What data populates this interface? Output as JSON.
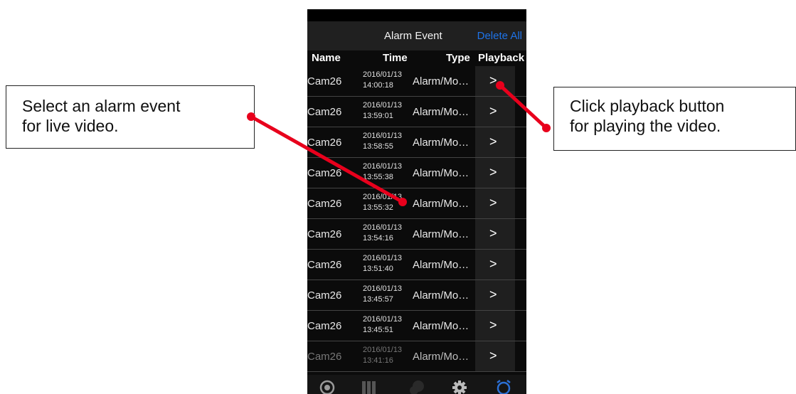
{
  "callouts": {
    "left": {
      "line1": "Select an alarm event",
      "line2": "for live video."
    },
    "right": {
      "line1": "Click playback button",
      "line2": "for playing the video."
    }
  },
  "nav": {
    "title": "Alarm Event",
    "delete_all": "Delete All"
  },
  "columns": {
    "name": "Name",
    "time": "Time",
    "type": "Type",
    "playback": "Playback"
  },
  "events": [
    {
      "name": "Cam26",
      "date": "2016/01/13",
      "time": "14:00:18",
      "type": "Alarm/Mo…",
      "play": ">"
    },
    {
      "name": "Cam26",
      "date": "2016/01/13",
      "time": "13:59:01",
      "type": "Alarm/Mo…",
      "play": ">"
    },
    {
      "name": "Cam26",
      "date": "2016/01/13",
      "time": "13:58:55",
      "type": "Alarm/Mo…",
      "play": ">"
    },
    {
      "name": "Cam26",
      "date": "2016/01/13",
      "time": "13:55:38",
      "type": "Alarm/Mo…",
      "play": ">"
    },
    {
      "name": "Cam26",
      "date": "2016/01/13",
      "time": "13:55:32",
      "type": "Alarm/Mo…",
      "play": ">"
    },
    {
      "name": "Cam26",
      "date": "2016/01/13",
      "time": "13:54:16",
      "type": "Alarm/Mo…",
      "play": ">"
    },
    {
      "name": "Cam26",
      "date": "2016/01/13",
      "time": "13:51:40",
      "type": "Alarm/Mo…",
      "play": ">"
    },
    {
      "name": "Cam26",
      "date": "2016/01/13",
      "time": "13:45:57",
      "type": "Alarm/Mo…",
      "play": ">"
    },
    {
      "name": "Cam26",
      "date": "2016/01/13",
      "time": "13:45:51",
      "type": "Alarm/Mo…",
      "play": ">"
    },
    {
      "name": "Cam26",
      "date": "2016/01/13",
      "time": "13:41:16",
      "type": "Alarm/Mo…",
      "play": ">"
    }
  ],
  "tabs": [
    {
      "icon": "live-view-icon"
    },
    {
      "icon": "device-list-icon"
    },
    {
      "icon": "group-settings-icon"
    },
    {
      "icon": "settings-gear-icon"
    },
    {
      "icon": "alarm-clock-icon"
    }
  ],
  "colors": {
    "annotation_red": "#e8001c",
    "accent_blue": "#1e73e8",
    "phone_bg": "#0b0b0b"
  }
}
